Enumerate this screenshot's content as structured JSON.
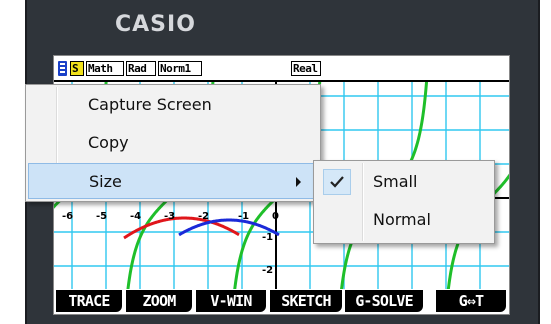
{
  "calculator": {
    "brand": "CASIO"
  },
  "status_bar": {
    "tags": [
      "S",
      "Math",
      "Rad",
      "Norm1",
      "Real"
    ]
  },
  "graph": {
    "x_tick_labels": [
      "-6",
      "-5",
      "-4",
      "-3",
      "-2",
      "-1",
      "0"
    ],
    "y_tick_labels": [
      "-1",
      "-2"
    ],
    "colors": {
      "grid": "#30c8f0",
      "axis": "#000000",
      "tangent_curve": "#1fbf2a",
      "red_curve": "#e0161b",
      "blue_curve": "#1b2ad8"
    }
  },
  "function_keys": [
    "TRACE",
    "ZOOM",
    "V-WIN",
    "SKETCH",
    "G-SOLVE",
    "G⇔T"
  ],
  "context_menu": {
    "items": [
      {
        "label": "Capture Screen",
        "has_submenu": false
      },
      {
        "label": "Copy",
        "has_submenu": false
      },
      {
        "label": "Size",
        "has_submenu": true,
        "highlighted": true
      }
    ]
  },
  "size_submenu": {
    "items": [
      {
        "label": "Small",
        "checked": true
      },
      {
        "label": "Normal",
        "checked": false
      }
    ]
  }
}
